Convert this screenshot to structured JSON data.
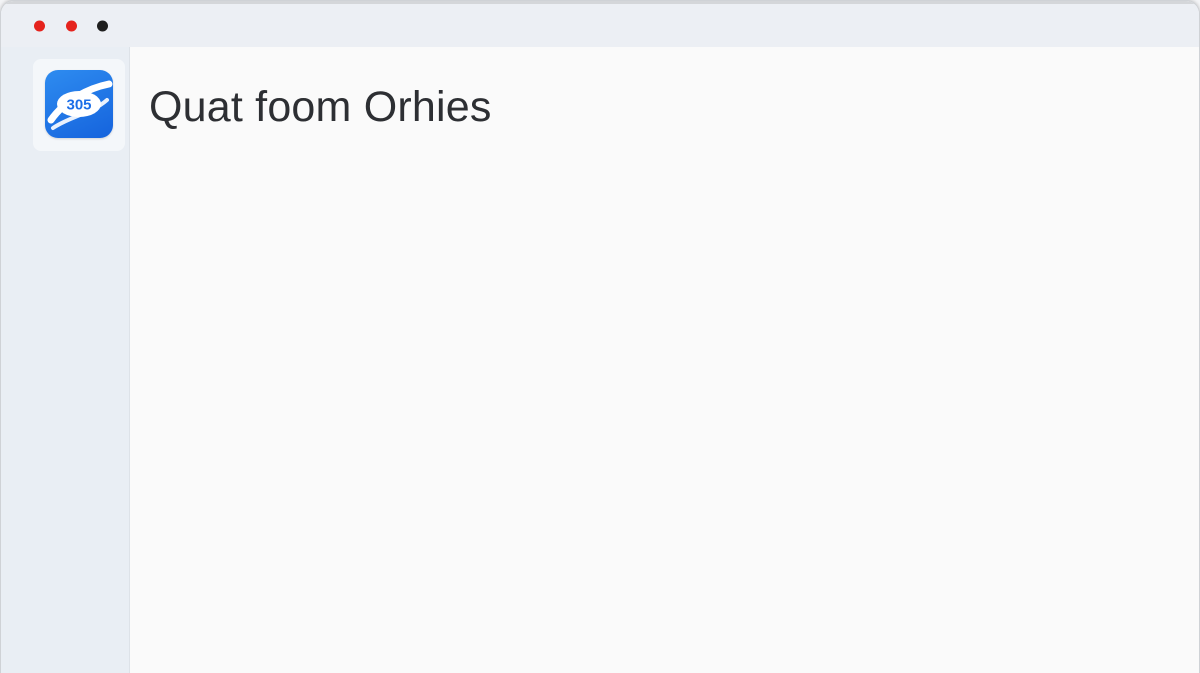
{
  "window": {
    "title": "Quat foom Orhies",
    "controls": [
      {
        "name": "close",
        "color": "#e5231d"
      },
      {
        "name": "minimize",
        "color": "#e5231d"
      },
      {
        "name": "zoom",
        "color": "#1f1f1f"
      }
    ]
  },
  "app": {
    "icon_name": "app-logo-icon",
    "icon_color": "#1d6fe8",
    "icon_text": "305"
  },
  "header": {
    "title": "Quat foom Orhies"
  }
}
